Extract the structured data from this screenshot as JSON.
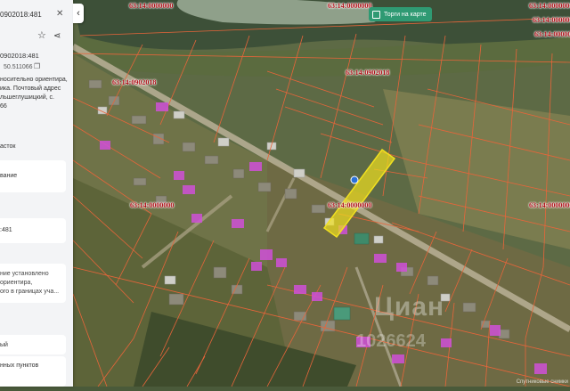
{
  "sidebar": {
    "title": "0902018:481",
    "cad_number": "0902018:481",
    "area_code": "50.511066",
    "address_lines": [
      "носительно ориентира,",
      "ика. Почтовый адрес",
      "льшеглушицкий, с.",
      "66"
    ],
    "type_label": "асток",
    "category_label": "вание",
    "number_value": ":481",
    "note_lines": [
      "ние установлено",
      "ориентира,",
      "ого в границах уча..."
    ],
    "bottom1": "ый",
    "bottom2": "нных пунктов"
  },
  "map": {
    "cadastral_labels": [
      "63:14:0000000",
      "63:14:0000000",
      "63:14:0000000",
      "63:14:0902018",
      "63:14:0902018",
      "63:14:0000000",
      "63:14:0000000",
      "63:14:0000000",
      "63:14:0000000",
      "63:14:0000000"
    ],
    "torgi_button": "Торги на карте",
    "watermark": "Циан",
    "watermark_id": "1026624",
    "attribution": "Спутниковые снимки"
  },
  "colors": {
    "parcel_border": "#e8653a",
    "selected_parcel": "#f0e020",
    "building_highlight": "#d050d8",
    "river": "#3c4f38",
    "button": "#2f9a73"
  }
}
